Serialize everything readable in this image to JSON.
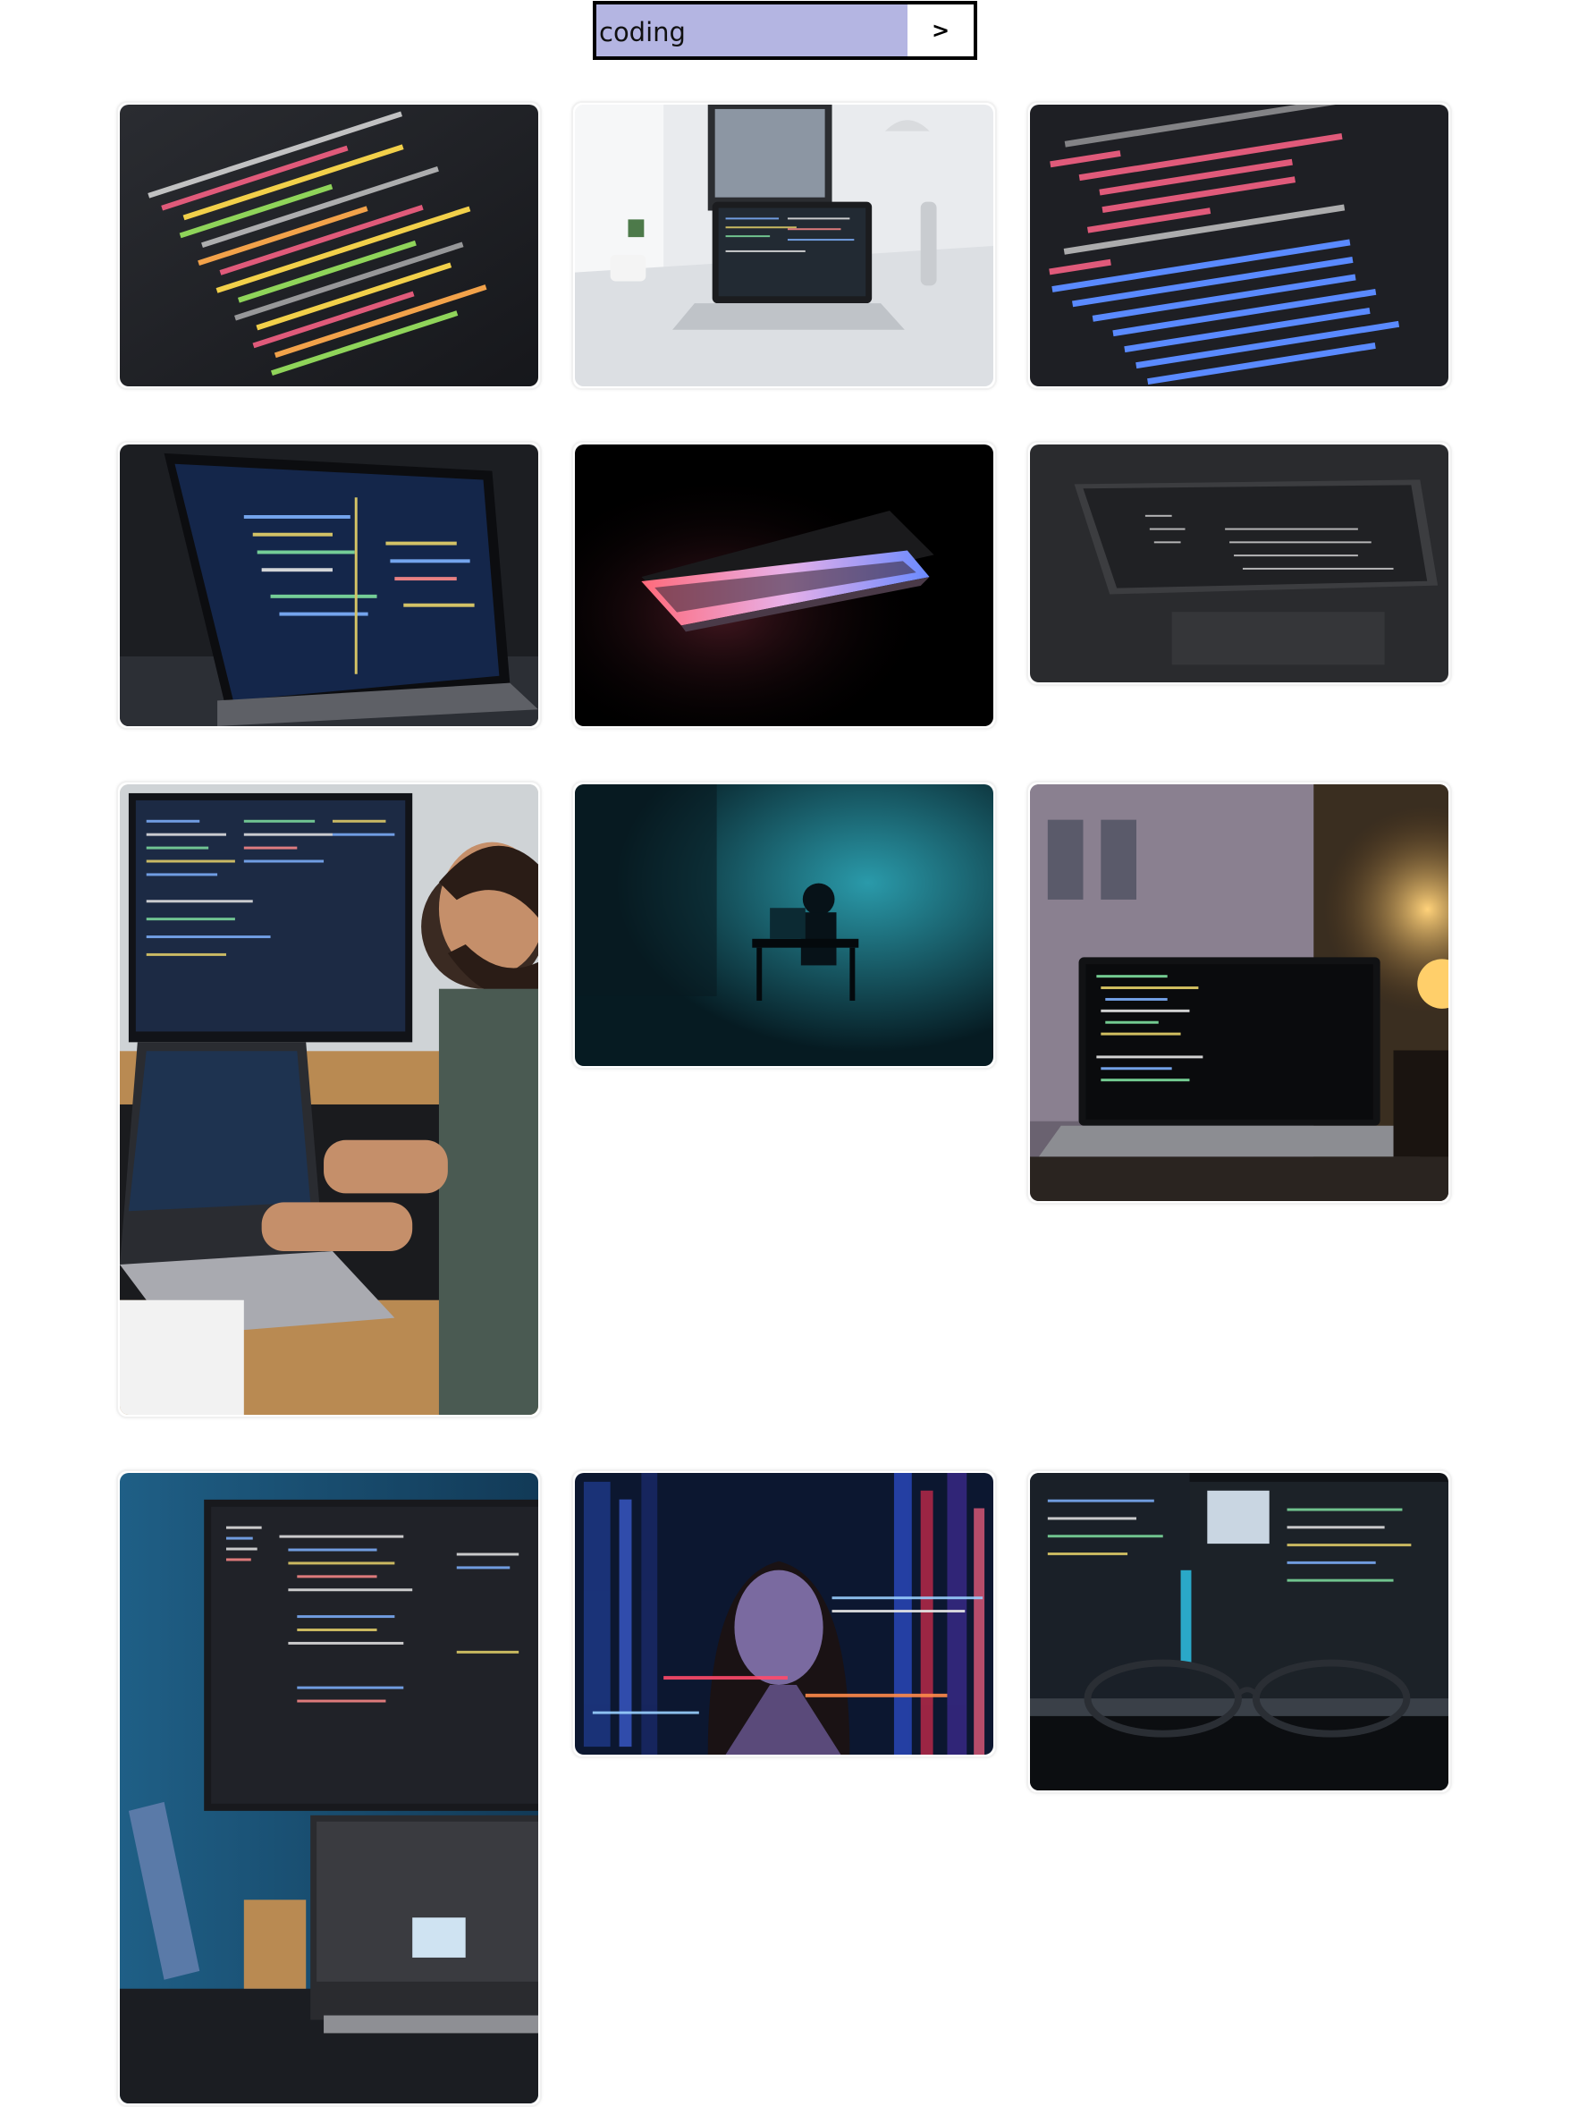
{
  "search": {
    "value": "coding",
    "submit_label": ">"
  },
  "results": [
    {
      "id": 1,
      "subject": "code-closeup-icon"
    },
    {
      "id": 2,
      "subject": "laptop-desk-icon"
    },
    {
      "id": 3,
      "subject": "svg-code-icon"
    },
    {
      "id": 4,
      "subject": "laptop-code-icon"
    },
    {
      "id": 5,
      "subject": "glowing-laptop-icon"
    },
    {
      "id": 6,
      "subject": "dark-laptop-icon"
    },
    {
      "id": 7,
      "subject": "developer-at-desk-icon"
    },
    {
      "id": 8,
      "subject": "hooded-figure-icon"
    },
    {
      "id": 9,
      "subject": "laptop-window-lamp-icon"
    },
    {
      "id": 10,
      "subject": "monitor-code-blue-icon"
    },
    {
      "id": 11,
      "subject": "projected-code-woman-icon"
    },
    {
      "id": 12,
      "subject": "glasses-monitors-icon"
    }
  ]
}
